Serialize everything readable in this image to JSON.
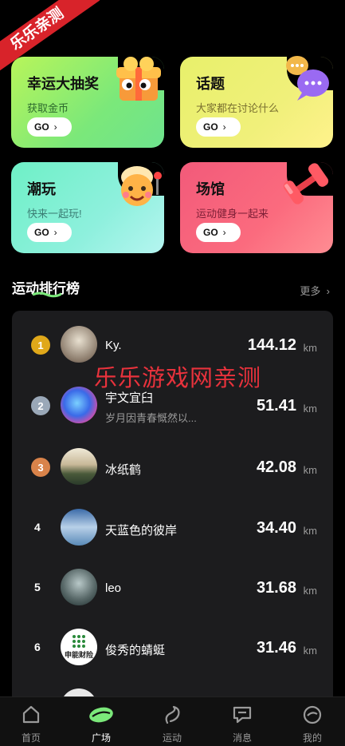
{
  "badge": "乐乐亲测",
  "watermark": "乐乐游戏网亲测",
  "cards": [
    {
      "title": "幸运大抽奖",
      "subtitle": "获取金币",
      "go": "GO"
    },
    {
      "title": "话题",
      "subtitle": "大家都在讨论什么",
      "go": "GO"
    },
    {
      "title": "潮玩",
      "subtitle": "快来一起玩!",
      "go": "GO"
    },
    {
      "title": "场馆",
      "subtitle": "运动健身一起来",
      "go": "GO"
    }
  ],
  "ranking": {
    "title": "运动排行榜",
    "more": "更多",
    "unit": "km",
    "rows": [
      {
        "rank": "1",
        "name": "Ky.",
        "signature": "",
        "distance": "144.12"
      },
      {
        "rank": "2",
        "name": "宇文宜臼",
        "signature": "岁月因青春慨然以...",
        "distance": "51.41"
      },
      {
        "rank": "3",
        "name": "冰纸鹤",
        "signature": "",
        "distance": "42.08"
      },
      {
        "rank": "4",
        "name": "天蓝色的彼岸",
        "signature": "",
        "distance": "34.40"
      },
      {
        "rank": "5",
        "name": "leo",
        "signature": "",
        "distance": "31.68"
      },
      {
        "rank": "6",
        "name": "俊秀的蜻蜓",
        "signature": "",
        "distance": "31.46"
      }
    ],
    "avatar6_text": "申能财险"
  },
  "tabs": [
    {
      "label": "首页",
      "icon": "home-icon"
    },
    {
      "label": "广场",
      "icon": "plaza-icon"
    },
    {
      "label": "运动",
      "icon": "sport-icon"
    },
    {
      "label": "消息",
      "icon": "message-icon"
    },
    {
      "label": "我的",
      "icon": "profile-icon"
    }
  ],
  "colors": {
    "accent": "#7be87a",
    "medal_gold": "#e0a81a",
    "medal_silver": "#9aa8b8",
    "medal_bronze": "#d9834a"
  }
}
